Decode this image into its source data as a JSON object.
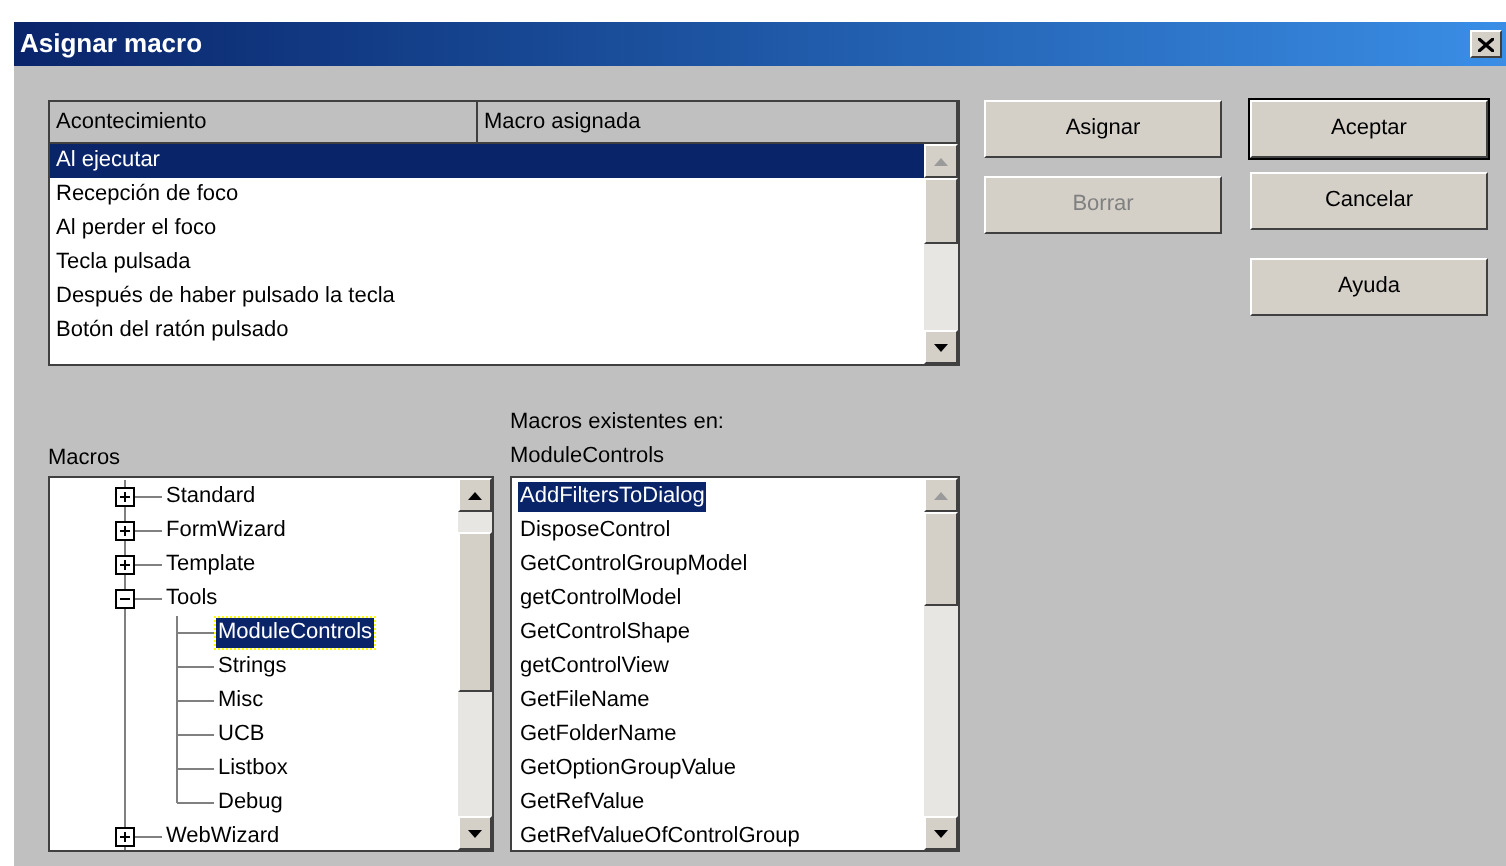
{
  "window": {
    "title": "Asignar macro"
  },
  "events_table": {
    "columns": [
      "Acontecimiento",
      "Macro asignada"
    ],
    "rows": [
      {
        "event": "Al ejecutar",
        "selected": true
      },
      {
        "event": "Recepción de foco",
        "selected": false
      },
      {
        "event": "Al perder el foco",
        "selected": false
      },
      {
        "event": "Tecla pulsada",
        "selected": false
      },
      {
        "event": "Después de haber pulsado la tecla",
        "selected": false
      },
      {
        "event": "Botón del ratón pulsado",
        "selected": false
      }
    ]
  },
  "action_buttons": [
    {
      "label": "Asignar",
      "disabled": false
    },
    {
      "label": "Borrar",
      "disabled": true
    }
  ],
  "dialog_buttons": [
    {
      "label": "Aceptar",
      "default": true
    },
    {
      "label": "Cancelar",
      "default": false
    },
    {
      "label": "Ayuda",
      "default": false
    }
  ],
  "macros_tree": {
    "label": "Macros",
    "items": [
      {
        "name": "Standard",
        "selected": false,
        "expanded": false
      },
      {
        "name": "FormWizard",
        "selected": false,
        "expanded": false
      },
      {
        "name": "Template",
        "selected": false,
        "expanded": false
      },
      {
        "name": "Tools",
        "selected": false,
        "expanded": true,
        "children": [
          {
            "name": "ModuleControls",
            "selected": true
          },
          {
            "name": "Strings",
            "selected": false
          },
          {
            "name": "Misc",
            "selected": false
          },
          {
            "name": "UCB",
            "selected": false
          },
          {
            "name": "Listbox",
            "selected": false
          },
          {
            "name": "Debug",
            "selected": false
          }
        ]
      },
      {
        "name": "WebWizard",
        "selected": false,
        "expanded": false
      }
    ]
  },
  "macro_list": {
    "label": "Macros existentes en:",
    "module": "ModuleControls",
    "items": [
      {
        "name": "AddFiltersToDialog",
        "selected": true
      },
      {
        "name": "DisposeControl",
        "selected": false
      },
      {
        "name": "GetControlGroupModel",
        "selected": false
      },
      {
        "name": "getControlModel",
        "selected": false
      },
      {
        "name": "GetControlShape",
        "selected": false
      },
      {
        "name": "getControlView",
        "selected": false
      },
      {
        "name": "GetFileName",
        "selected": false
      },
      {
        "name": "GetFolderName",
        "selected": false
      },
      {
        "name": "GetOptionGroupValue",
        "selected": false
      },
      {
        "name": "GetRefValue",
        "selected": false
      },
      {
        "name": "GetRefValueOfControlGroup",
        "selected": false
      }
    ]
  }
}
